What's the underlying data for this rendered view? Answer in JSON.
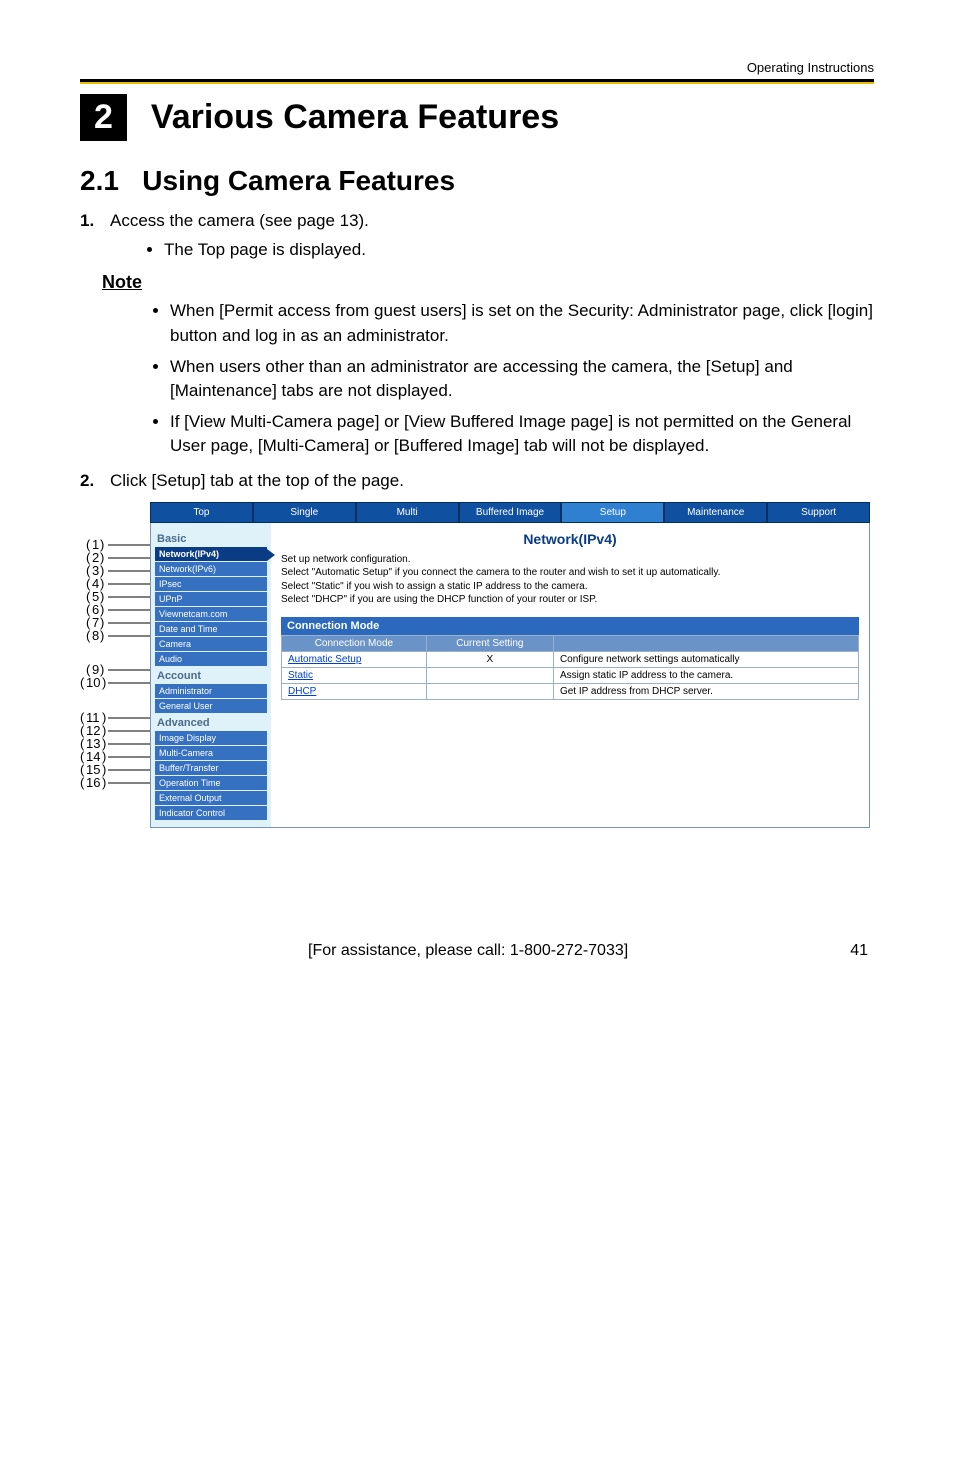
{
  "running_head": "Operating Instructions",
  "chapter": {
    "number": "2",
    "title": "Various Camera Features"
  },
  "section": {
    "number": "2.1",
    "title": "Using Camera Features"
  },
  "steps": [
    {
      "num": "1.",
      "text": "Access the camera (see page 13).",
      "subs": [
        "The Top page is displayed."
      ]
    },
    {
      "num": "2.",
      "text": "Click [Setup] tab at the top of the page."
    }
  ],
  "note_head": "Note",
  "notes": [
    "When [Permit access from guest users] is set on the Security: Administrator page, click [login] button and log in as an administrator.",
    "When users other than an administrator are accessing the camera, the [Setup] and [Maintenance] tabs are not displayed.",
    "If [View Multi-Camera page] or [View Buffered Image page] is not permitted on the General User page, [Multi-Camera] or [Buffered Image] tab will not be displayed."
  ],
  "screenshot": {
    "tabs": [
      "Top",
      "Single",
      "Multi",
      "Buffered Image",
      "Setup",
      "Maintenance",
      "Support"
    ],
    "selected_tab": "Setup",
    "sidebar": {
      "groups": [
        {
          "head": "Basic",
          "items": [
            "Network(IPv4)",
            "Network(IPv6)",
            "IPsec",
            "UPnP",
            "Viewnetcam.com",
            "Date and Time",
            "Camera",
            "Audio"
          ],
          "selected": "Network(IPv4)"
        },
        {
          "head": "Account",
          "items": [
            "Administrator",
            "General User"
          ]
        },
        {
          "head": "Advanced",
          "items": [
            "Image Display",
            "Multi-Camera",
            "Buffer/Transfer",
            "Operation Time",
            "External Output",
            "Indicator Control"
          ]
        }
      ]
    },
    "main": {
      "title": "Network(IPv4)",
      "desc_lines": [
        "Set up network configuration.",
        "Select \"Automatic Setup\" if you connect the camera to the router and wish to set it up automatically.",
        "Select \"Static\" if you wish to assign a static IP address to the camera.",
        "Select \"DHCP\" if you are using the DHCP function of your router or ISP."
      ],
      "cm_head": "Connection Mode",
      "cm_headers": [
        "Connection Mode",
        "Current Setting",
        ""
      ],
      "cm_rows": [
        {
          "mode": "Automatic Setup",
          "current": "X",
          "note": "Configure network settings automatically"
        },
        {
          "mode": "Static",
          "current": "",
          "note": "Assign static IP address to the camera."
        },
        {
          "mode": "DHCP",
          "current": "",
          "note": "Get IP address from DHCP server."
        }
      ]
    }
  },
  "callout_numbers": [
    "1",
    "2",
    "3",
    "4",
    "5",
    "6",
    "7",
    "8",
    "9",
    "10",
    "11",
    "12",
    "13",
    "14",
    "15",
    "16"
  ],
  "footer": {
    "assist": "[For assistance, please call: 1-800-272-7033]",
    "page": "41"
  }
}
